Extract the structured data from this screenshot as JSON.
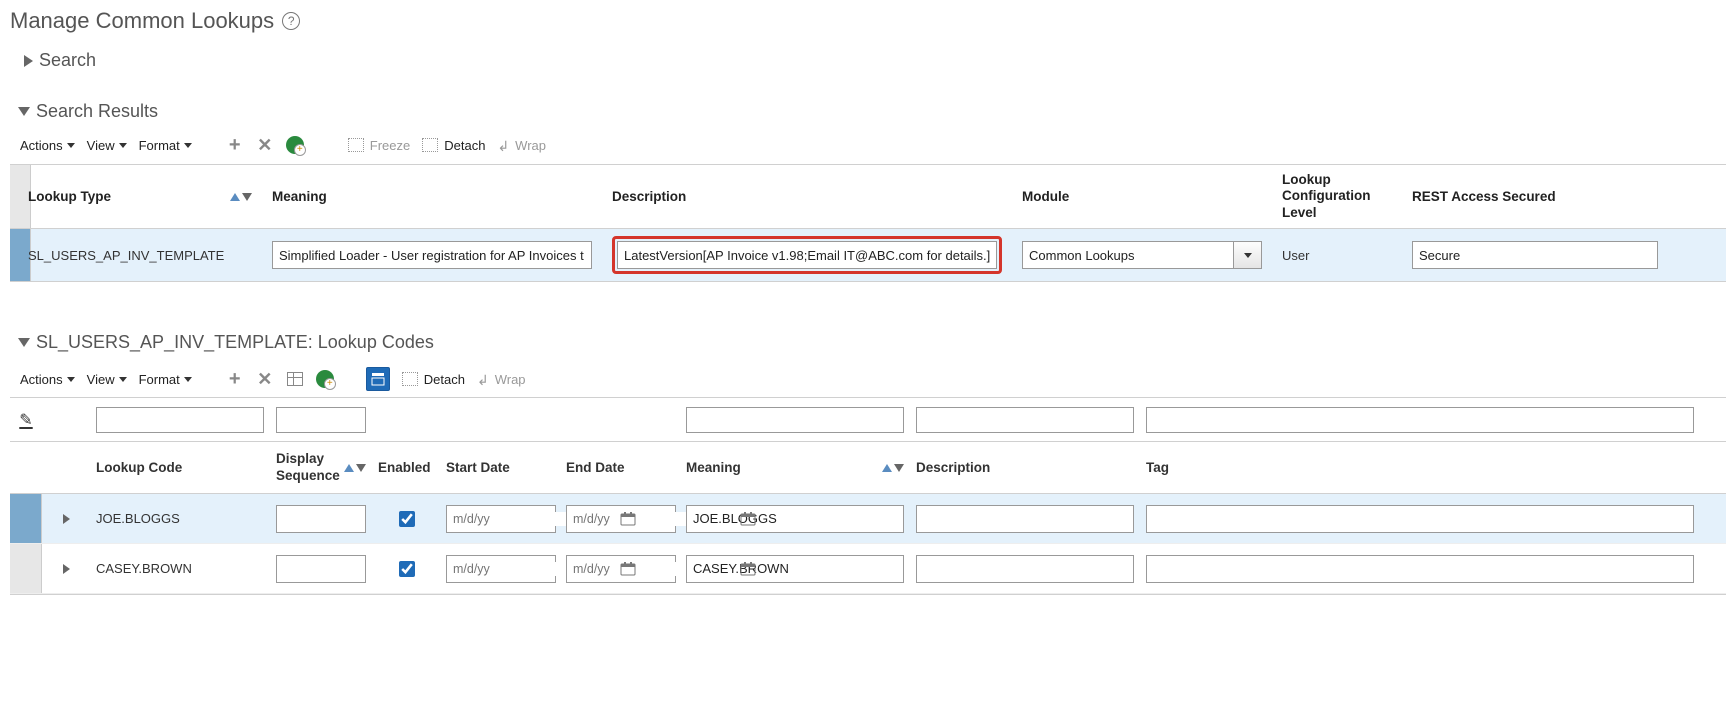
{
  "page": {
    "title": "Manage Common Lookups"
  },
  "sections": {
    "search": "Search",
    "results": "Search Results",
    "codes": "SL_USERS_AP_INV_TEMPLATE: Lookup Codes"
  },
  "toolbar": {
    "actions": "Actions",
    "view": "View",
    "format": "Format",
    "freeze": "Freeze",
    "detach": "Detach",
    "wrap": "Wrap"
  },
  "resultsHeaders": {
    "lookupType": "Lookup Type",
    "meaning": "Meaning",
    "description": "Description",
    "module": "Module",
    "configLevel": "Lookup Configuration Level",
    "restAccess": "REST Access Secured"
  },
  "resultRow": {
    "lookupType": "SL_USERS_AP_INV_TEMPLATE",
    "meaning": "Simplified Loader - User registration for AP Invoices t",
    "description": "LatestVersion[AP Invoice v1.98;Email IT@ABC.com for details.]",
    "module": "Common Lookups",
    "configLevel": "User",
    "restAccess": "Secure"
  },
  "codesHeaders": {
    "lookupCode": "Lookup Code",
    "displaySeq": "Display Sequence",
    "enabled": "Enabled",
    "startDate": "Start Date",
    "endDate": "End Date",
    "meaning": "Meaning",
    "description": "Description",
    "tag": "Tag"
  },
  "datePlaceholder": "m/d/yy",
  "codeRows": [
    {
      "lookupCode": "JOE.BLOGGS",
      "displaySeq": "",
      "enabled": true,
      "startDate": "",
      "endDate": "",
      "meaning": "JOE.BLOGGS",
      "description": "",
      "tag": ""
    },
    {
      "lookupCode": "CASEY.BROWN",
      "displaySeq": "",
      "enabled": true,
      "startDate": "",
      "endDate": "",
      "meaning": "CASEY.BROWN",
      "description": "",
      "tag": ""
    }
  ]
}
